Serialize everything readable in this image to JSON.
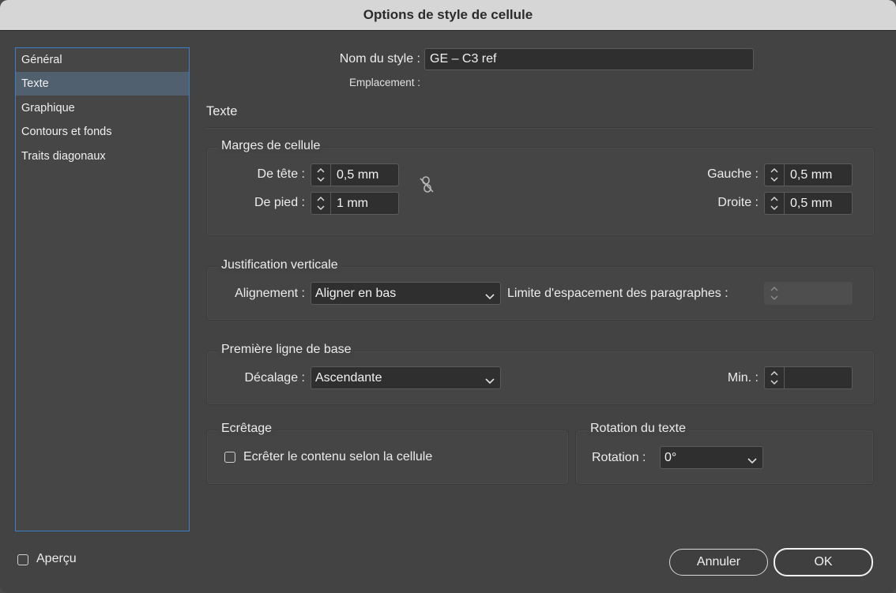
{
  "window": {
    "title": "Options de style de cellule"
  },
  "sidebar": {
    "items": [
      {
        "label": "Général"
      },
      {
        "label": "Texte",
        "active": true
      },
      {
        "label": "Graphique"
      },
      {
        "label": "Contours et fonds"
      },
      {
        "label": "Traits diagonaux"
      }
    ]
  },
  "header": {
    "style_name_label": "Nom du style :",
    "style_name_value": "GE – C3 ref",
    "location_label": "Emplacement :",
    "section_title": "Texte"
  },
  "cell_margins": {
    "title": "Marges de cellule",
    "top_label": "De tête :",
    "top_value": "0,5 mm",
    "bottom_label": "De pied :",
    "bottom_value": "1 mm",
    "left_label": "Gauche :",
    "left_value": "0,5 mm",
    "right_label": "Droite :",
    "right_value": "0,5 mm",
    "link_icon": "broken-link-icon"
  },
  "vertical_justification": {
    "title": "Justification verticale",
    "alignment_label": "Alignement :",
    "alignment_value": "Aligner en bas",
    "paragraph_spacing_label": "Limite d'espacement des paragraphes :",
    "paragraph_spacing_value": ""
  },
  "first_baseline": {
    "title": "Première ligne de base",
    "offset_label": "Décalage :",
    "offset_value": "Ascendante",
    "min_label": "Min. :",
    "min_value": ""
  },
  "clipping": {
    "title": "Ecrêtage",
    "checkbox_label": "Ecrêter le contenu selon la cellule",
    "checked": false
  },
  "text_rotation": {
    "title": "Rotation du texte",
    "rotation_label": "Rotation :",
    "rotation_value": "0°"
  },
  "footer": {
    "preview_label": "Aperçu",
    "preview_checked": false,
    "cancel_label": "Annuler",
    "ok_label": "OK"
  },
  "colors": {
    "accent": "#3a7fc7",
    "selected_item": "#51606f",
    "background": "#434343"
  }
}
